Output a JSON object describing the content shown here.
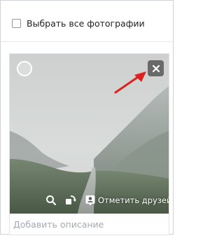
{
  "select_all": {
    "label": "Выбрать все фотографии",
    "checked": false
  },
  "photo_card": {
    "tag_friends_label": "Отметить друзей",
    "description_placeholder": "Добавить описание",
    "icons": [
      "select-circle-icon",
      "close-icon",
      "zoom-icon",
      "rotate-icon",
      "person-tag-icon"
    ]
  },
  "colors": {
    "annotation_arrow": "#e02020",
    "placeholder_text": "#a4a9b0"
  }
}
